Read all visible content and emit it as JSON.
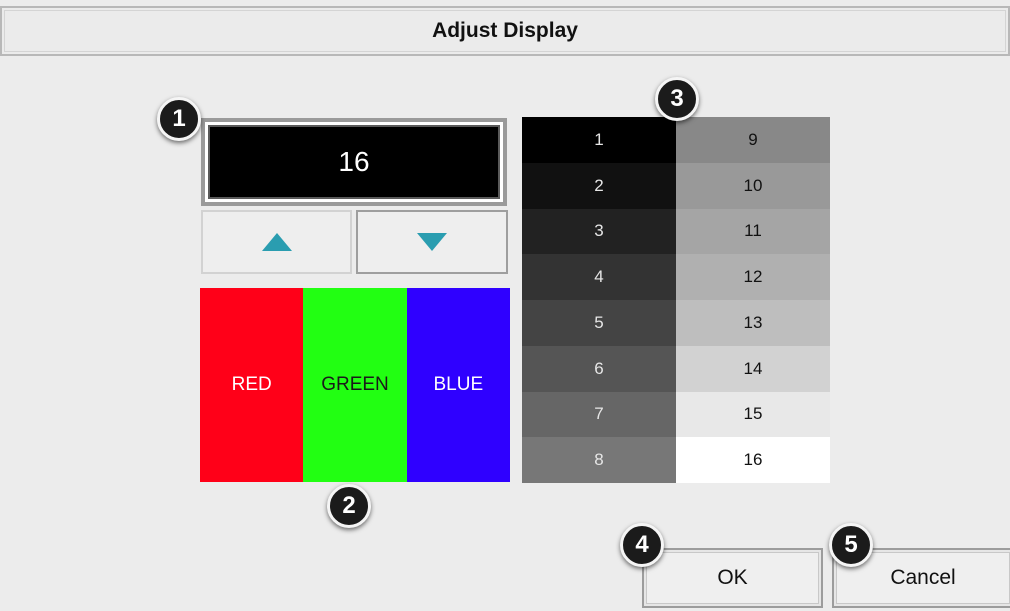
{
  "title": "Adjust Display",
  "value_display": {
    "value": "16"
  },
  "stepper": {
    "up_icon": "up-triangle-icon",
    "down_icon": "down-triangle-icon",
    "color": "#2a9db0"
  },
  "rgb_bars": [
    {
      "label": "RED",
      "color": "#ff0018",
      "text_color": "#ffffff"
    },
    {
      "label": "GREEN",
      "color": "#22ff12",
      "text_color": "#1a1a1a"
    },
    {
      "label": "BLUE",
      "color": "#2f00ff",
      "text_color": "#ffffff"
    }
  ],
  "grayscale": [
    {
      "label": "1",
      "color": "#000000",
      "text": "#e6e6e6"
    },
    {
      "label": "2",
      "color": "#111111",
      "text": "#e6e6e6"
    },
    {
      "label": "3",
      "color": "#222222",
      "text": "#e6e6e6"
    },
    {
      "label": "4",
      "color": "#333333",
      "text": "#e6e6e6"
    },
    {
      "label": "5",
      "color": "#444444",
      "text": "#e6e6e6"
    },
    {
      "label": "6",
      "color": "#555555",
      "text": "#e6e6e6"
    },
    {
      "label": "7",
      "color": "#666666",
      "text": "#e6e6e6"
    },
    {
      "label": "8",
      "color": "#777777",
      "text": "#e6e6e6"
    },
    {
      "label": "9",
      "color": "#888888",
      "text": "#111111"
    },
    {
      "label": "10",
      "color": "#999999",
      "text": "#111111"
    },
    {
      "label": "11",
      "color": "#a5a5a5",
      "text": "#111111"
    },
    {
      "label": "12",
      "color": "#b0b0b0",
      "text": "#111111"
    },
    {
      "label": "13",
      "color": "#bebebe",
      "text": "#111111"
    },
    {
      "label": "14",
      "color": "#d2d2d2",
      "text": "#111111"
    },
    {
      "label": "15",
      "color": "#e8e8e8",
      "text": "#111111"
    },
    {
      "label": "16",
      "color": "#ffffff",
      "text": "#111111"
    }
  ],
  "buttons": {
    "ok": "OK",
    "cancel": "Cancel"
  },
  "callouts": [
    "1",
    "2",
    "3",
    "4",
    "5"
  ]
}
